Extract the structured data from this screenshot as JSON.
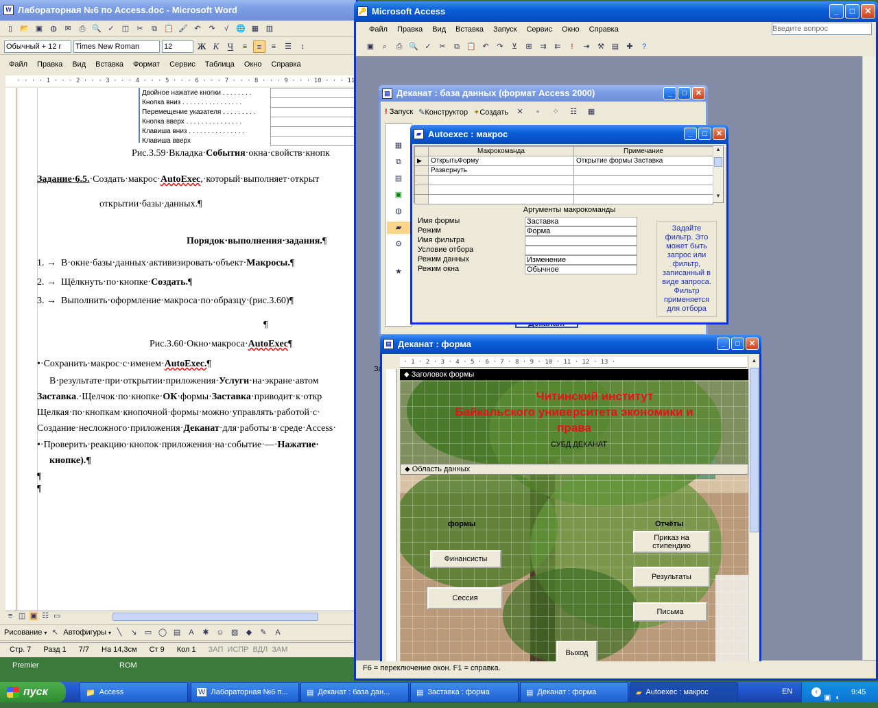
{
  "desktop": {
    "icon1": "Premier",
    "icon2": "ROM"
  },
  "word": {
    "title": "Лабораторная №6 по Access.doc - Microsoft Word",
    "style": "Обычный + 12 г",
    "font": "Times New Roman",
    "size": "12",
    "menu": [
      "Файл",
      "Правка",
      "Вид",
      "Вставка",
      "Формат",
      "Сервис",
      "Таблица",
      "Окно",
      "Справка"
    ],
    "table_rows": [
      "Двойное нажатие кнопки . . . . . . . .",
      "Кнопка вниз . . . . . . . . . . . . . . . .",
      "Перемещение указателя . . . . . . . . .",
      "Кнопка вверх . . . . . . . . . . . . . . .",
      "Клавиша вниз . . . . . . . . . . . . . . .",
      "Клавиша вверх"
    ],
    "caption359": "Рис.3.59·Вкладка·",
    "caption359b": "События",
    "caption359c": "·окна·свойств·кнопк",
    "task_label": "Задание·6.5.",
    "task_text": "·Создать·макрос·",
    "task_bold": "AutoExec",
    "task_rest": ",·который·выполняет·открыт",
    "task_line2": "открытии·базы·данных.¶",
    "order_title": "Порядок·выполнения·задания.",
    "order_mark": "¶",
    "steps": [
      {
        "num": "1.",
        "text": "В·окне·базы·данных·активизировать·объект·",
        "bold": "Макросы.",
        "end": "¶"
      },
      {
        "num": "2.",
        "text": "Щёлкнуть·по·кнопке·",
        "bold": "Создать.",
        "end": "¶"
      },
      {
        "num": "3.",
        "text": "Выполнить·оформление·макроса·по·образцу·(рис.3.60)",
        "bold": "",
        "end": "¶"
      }
    ],
    "pilcrow": "¶",
    "caption360": "Рис.3.60·Окно·макроса·",
    "caption360b": "AutoExec",
    "caption360c": "¶",
    "save_text": "•·Сохранить·макрос·с·именем·",
    "save_bold": "AutoExec.",
    "save_end": "¶",
    "p1a": "В·результате·при·открытии·приложения·",
    "p1b": "Услуги",
    "p1c": "·на·экране·автом",
    "p2a": "Заставка",
    "p2b": ".·Щелчок·по·кнопке·",
    "p2c": "ОК",
    "p2d": "·формы·",
    "p2e": "Заставка",
    "p2f": "·приводит·к·откр",
    "p3": "Щелкая·по·кнопкам·кнопочной·формы·можно·управлять·работой·с·",
    "p4a": "Создание·несложного·приложения·",
    "p4b": "Деканат",
    "p4c": "·для·работы·в·среде·Access·",
    "p5a": "•·Проверить·реакцию·кнопок·приложения·на·событие·—·",
    "p5b": "Нажатие·",
    "p6": "кнопке).¶",
    "p7": "¶",
    "p8": "¶",
    "draw_label": "Рисование",
    "autoshapes_label": "Автофигуры",
    "status": {
      "page": "Стр. 7",
      "section": "Разд 1",
      "pages": "7/7",
      "pos": "На 14,3см",
      "line": "Ст 9",
      "col": "Кол 1",
      "rec": "ЗАП",
      "trk": "ИСПР",
      "ext": "ВДЛ",
      "ovr": "ЗАМ"
    }
  },
  "access": {
    "title": "Microsoft Access",
    "menu": [
      "Файл",
      "Правка",
      "Вид",
      "Вставка",
      "Запуск",
      "Сервис",
      "Окно",
      "Справка"
    ],
    "ask_placeholder": "Введите вопрос",
    "status": "F6 = переключение окон.  F1 = справка."
  },
  "db": {
    "title": "Деканат : база данных (формат Access 2000)",
    "run_label": "Запуск",
    "design_label": "Конструктор",
    "create_label": "Создать",
    "side_label": "Зa"
  },
  "macro": {
    "title": "Autoexec : макрос",
    "col1": "Макрокоманда",
    "col2": "Примечание",
    "rows": [
      {
        "action": "ОткрытьФорму",
        "note": "Открытие формы Заставка"
      },
      {
        "action": "Развернуть",
        "note": ""
      },
      {
        "action": "",
        "note": ""
      },
      {
        "action": "",
        "note": ""
      },
      {
        "action": "",
        "note": ""
      }
    ],
    "args_title": "Аргументы макрокоманды",
    "args": [
      {
        "name": "Имя формы",
        "value": "Заставка"
      },
      {
        "name": "Режим",
        "value": "Форма"
      },
      {
        "name": "Имя фильтра",
        "value": ""
      },
      {
        "name": "Условие отбора",
        "value": ""
      },
      {
        "name": "Режим данных",
        "value": "Изменение"
      },
      {
        "name": "Режим окна",
        "value": "Обычное"
      }
    ],
    "help": "Задайте фильтр. Это может быть запрос или фильтр, записанный в виде запроса. Фильтр применяется для отбора"
  },
  "form": {
    "title": "Деканат : форма",
    "header_section": "Заголовок формы",
    "detail_section": "Область данных",
    "title_line1": "Читинский институт",
    "title_line2": "Байкальского университета экономики и",
    "title_line3": "права",
    "subtitle": "СУБД ДЕКАНАТ",
    "label_forms": "формы",
    "label_reports": "Отчёты",
    "btn_fin": "Финансисты",
    "btn_session": "Сессия",
    "btn_order": "Приказ на стипендию",
    "btn_results": "Результаты",
    "btn_letters": "Письма",
    "btn_exit": "Выход",
    "behind_text": "Деканат"
  },
  "taskbar": {
    "start": "пуск",
    "items": [
      "Access",
      "Лабораторная №6 п...",
      "Деканат : база дан...",
      "Заставка : форма",
      "Деканат : форма",
      "Autoexec : макрос"
    ],
    "lang": "EN",
    "time": "9:45"
  }
}
